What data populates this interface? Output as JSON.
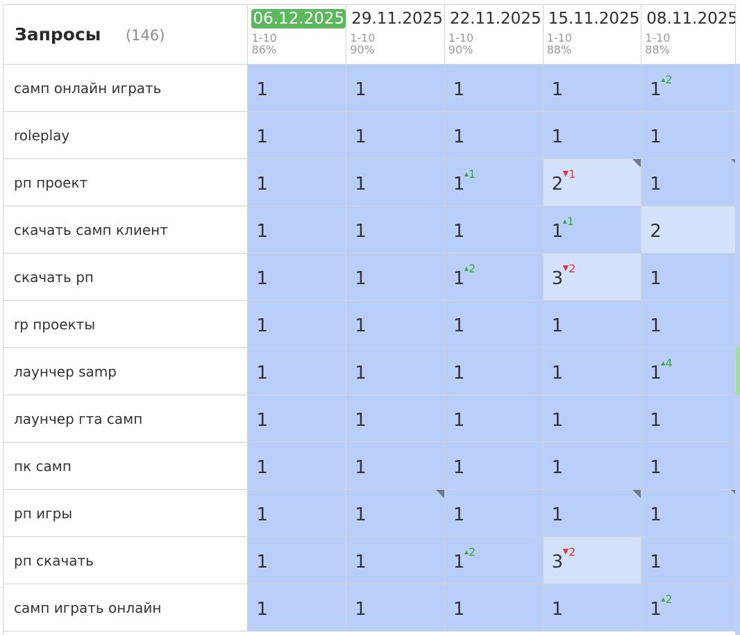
{
  "header": {
    "title": "Запросы",
    "count": "(146)",
    "columns": [
      {
        "date": "06.12.2025",
        "range": "1-10",
        "pct": "86%",
        "current": true
      },
      {
        "date": "29.11.2025",
        "range": "1-10",
        "pct": "90%",
        "current": false
      },
      {
        "date": "22.11.2025",
        "range": "1-10",
        "pct": "90%",
        "current": false
      },
      {
        "date": "15.11.2025",
        "range": "1-10",
        "pct": "88%",
        "current": false
      },
      {
        "date": "08.11.2025",
        "range": "1-10",
        "pct": "88%",
        "current": false
      }
    ]
  },
  "rows": [
    {
      "query": "самп онлайн играть",
      "cells": [
        {
          "v": "1"
        },
        {
          "v": "1"
        },
        {
          "v": "1"
        },
        {
          "v": "1"
        },
        {
          "v": "1",
          "change": "2",
          "dir": "up"
        }
      ]
    },
    {
      "query": "roleplay",
      "cells": [
        {
          "v": "1"
        },
        {
          "v": "1"
        },
        {
          "v": "1"
        },
        {
          "v": "1"
        },
        {
          "v": "1"
        }
      ]
    },
    {
      "query": "рп проект",
      "cells": [
        {
          "v": "1"
        },
        {
          "v": "1"
        },
        {
          "v": "1",
          "change": "1",
          "dir": "up"
        },
        {
          "v": "2",
          "change": "1",
          "dir": "down",
          "light": true,
          "flag": true
        },
        {
          "v": "1",
          "flag": true
        }
      ]
    },
    {
      "query": "скачать самп клиент",
      "cells": [
        {
          "v": "1"
        },
        {
          "v": "1"
        },
        {
          "v": "1"
        },
        {
          "v": "1",
          "change": "1",
          "dir": "up"
        },
        {
          "v": "2",
          "light": true
        }
      ]
    },
    {
      "query": "скачать рп",
      "cells": [
        {
          "v": "1"
        },
        {
          "v": "1"
        },
        {
          "v": "1",
          "change": "2",
          "dir": "up"
        },
        {
          "v": "3",
          "change": "2",
          "dir": "down",
          "light": true
        },
        {
          "v": "1"
        }
      ]
    },
    {
      "query": "rp проекты",
      "cells": [
        {
          "v": "1"
        },
        {
          "v": "1"
        },
        {
          "v": "1"
        },
        {
          "v": "1"
        },
        {
          "v": "1"
        }
      ]
    },
    {
      "query": "лаунчер samp",
      "cells": [
        {
          "v": "1"
        },
        {
          "v": "1"
        },
        {
          "v": "1"
        },
        {
          "v": "1"
        },
        {
          "v": "1",
          "change": "4",
          "dir": "up"
        }
      ]
    },
    {
      "query": "лаунчер гта самп",
      "cells": [
        {
          "v": "1"
        },
        {
          "v": "1"
        },
        {
          "v": "1"
        },
        {
          "v": "1"
        },
        {
          "v": "1"
        }
      ]
    },
    {
      "query": "пк самп",
      "cells": [
        {
          "v": "1"
        },
        {
          "v": "1"
        },
        {
          "v": "1"
        },
        {
          "v": "1"
        },
        {
          "v": "1"
        }
      ]
    },
    {
      "query": "рп игры",
      "cells": [
        {
          "v": "1"
        },
        {
          "v": "1",
          "flag": true
        },
        {
          "v": "1"
        },
        {
          "v": "1",
          "flag": true
        },
        {
          "v": "1",
          "flag": true
        }
      ]
    },
    {
      "query": "рп скачать",
      "cells": [
        {
          "v": "1"
        },
        {
          "v": "1"
        },
        {
          "v": "1",
          "change": "2",
          "dir": "up"
        },
        {
          "v": "3",
          "change": "2",
          "dir": "down",
          "light": true
        },
        {
          "v": "1"
        }
      ]
    },
    {
      "query": "самп играть онлайн",
      "cells": [
        {
          "v": "1"
        },
        {
          "v": "1"
        },
        {
          "v": "1"
        },
        {
          "v": "1"
        },
        {
          "v": "1",
          "change": "2",
          "dir": "up"
        }
      ]
    }
  ],
  "icons": {
    "up": "triangle-up-icon",
    "down": "triangle-down-icon",
    "flag": "corner-flag-icon"
  },
  "colors": {
    "cell": "#b9cff9",
    "cell_light": "#d3e1fb",
    "current_date": "#5cb85c",
    "up": "#3ea63e",
    "down": "#d63a3a"
  }
}
